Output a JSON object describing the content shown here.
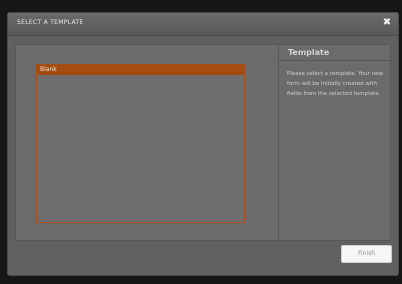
{
  "dialog": {
    "title": "SELECT A TEMPLATE",
    "close_icon": "close-icon",
    "close_glyph": "✖"
  },
  "template_list": {
    "items": [
      {
        "label": "Blank",
        "selected": true
      }
    ]
  },
  "info": {
    "title": "Template",
    "description": "Please select a template. Your new form will be initially created with fields from the selected template."
  },
  "footer": {
    "finish_label": "Finish"
  },
  "colors": {
    "selection": "#a44c10",
    "list_border": "#a4501e",
    "dialog_bg": "#606060",
    "backdrop": "#151515"
  }
}
